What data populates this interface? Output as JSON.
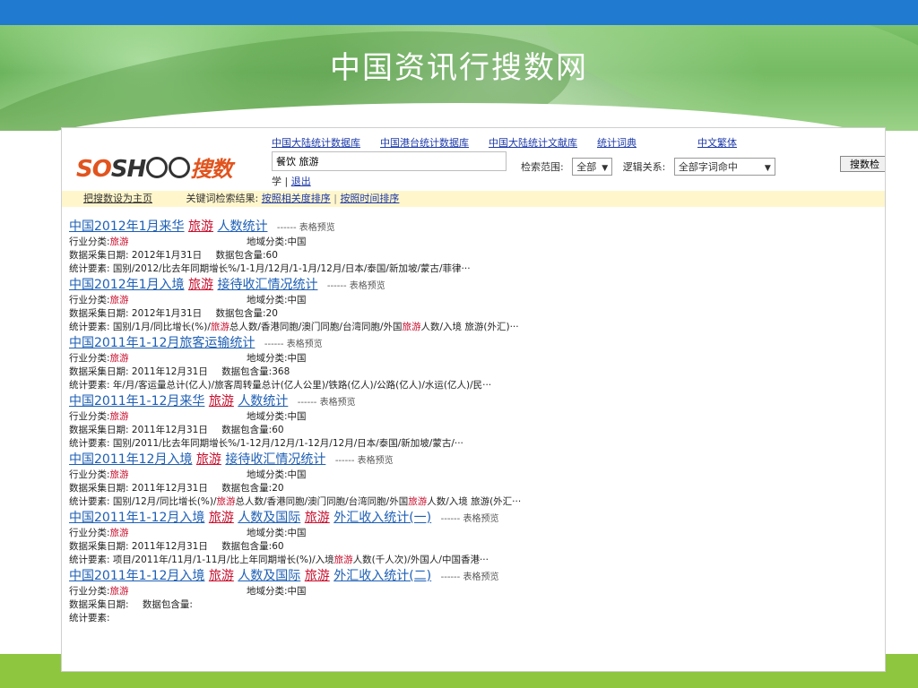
{
  "page_title": "中国资讯行搜数网",
  "header": {
    "db_links": [
      "中国大陆统计数据库",
      "中国港台统计数据库",
      "中国大陆统计文献库",
      "统计词典",
      "中文繁体"
    ],
    "search_value": "餐饮 旅游",
    "user_prefix": "学 | ",
    "logout": "退出",
    "scope_label": "检索范围:",
    "scope_value": "全部",
    "logic_label": "逻辑关系:",
    "logic_value": "全部字词命中",
    "search_button": "搜数检"
  },
  "bar": {
    "set_home": "把搜数设为主页",
    "kw_label": "关键词检索结果:",
    "sort_relevance": "按照相关度排序",
    "separator": "|",
    "sort_time": "按照时间排序"
  },
  "labels": {
    "industry": "行业分类:",
    "region": "地域分类:",
    "date": "数据采集日期:",
    "count": "数据包含量:",
    "elements": "统计要素:",
    "preview": "------ 表格预览"
  },
  "results": [
    {
      "t1": "中国2012年1月来华",
      "t2": "旅游",
      "t3": "人数统计",
      "t4": "",
      "t5": "",
      "industry": "旅游",
      "region": "中国",
      "date": "2012年1月31日",
      "count": "60",
      "e1": "国别/2012/比去年同期增长%/1-1月/12月/1-1月/12月/日本/泰国/新加坡/蒙古/菲律···",
      "e2": "",
      "e3": "",
      "e4": "",
      "e5": ""
    },
    {
      "t1": "中国2012年1月入境",
      "t2": "旅游",
      "t3": "接待收汇情况统计",
      "t4": "",
      "t5": "",
      "industry": "旅游",
      "region": "中国",
      "date": "2012年1月31日",
      "count": "20",
      "e1": "国别/1月/同比增长(%)/",
      "e2": "旅游",
      "e3": "总人数/香港同胞/澳门同胞/台湾同胞/外国",
      "e4": "旅游",
      "e5": "人数/入境 旅游(外汇)···"
    },
    {
      "t1": "中国2011年1-12月旅客运输统计",
      "t2": "",
      "t3": "",
      "t4": "",
      "t5": "",
      "industry": "旅游",
      "region": "中国",
      "date": "2011年12月31日",
      "count": "368",
      "e1": "年/月/客运量总计(亿人)/旅客周转量总计(亿人公里)/铁路(亿人)/公路(亿人)/水运(亿人)/民···",
      "e2": "",
      "e3": "",
      "e4": "",
      "e5": ""
    },
    {
      "t1": "中国2011年1-12月来华",
      "t2": "旅游",
      "t3": "人数统计",
      "t4": "",
      "t5": "",
      "industry": "旅游",
      "region": "中国",
      "date": "2011年12月31日",
      "count": "60",
      "e1": "国别/2011/比去年同期增长%/1-12月/12月/1-12月/12月/日本/泰国/新加坡/蒙古/···",
      "e2": "",
      "e3": "",
      "e4": "",
      "e5": ""
    },
    {
      "t1": "中国2011年12月入境",
      "t2": "旅游",
      "t3": "接待收汇情况统计",
      "t4": "",
      "t5": "",
      "industry": "旅游",
      "region": "中国",
      "date": "2011年12月31日",
      "count": "20",
      "e1": "国别/12月/同比增长(%)/",
      "e2": "旅游",
      "e3": "总人数/香港同胞/澳门同胞/台湾同胞/外国",
      "e4": "旅游",
      "e5": "人数/入境 旅游(外汇···"
    },
    {
      "t1": "中国2011年1-12月入境",
      "t2": "旅游",
      "t3": "人数及国际",
      "t4": "旅游",
      "t5": "外汇收入统计(一)",
      "industry": "旅游",
      "region": "中国",
      "date": "2011年12月31日",
      "count": "60",
      "e1": "项目/2011年/11月/1-11月/比上年同期增长(%)/入境",
      "e2": "旅游",
      "e3": "人数(千人次)/外国人/中国香港···",
      "e4": "",
      "e5": ""
    },
    {
      "t1": "中国2011年1-12月入境",
      "t2": "旅游",
      "t3": "人数及国际",
      "t4": "旅游",
      "t5": "外汇收入统计(二)",
      "industry": "旅游",
      "region": "中国",
      "date": "",
      "count": "",
      "e1": "",
      "e2": "",
      "e3": "",
      "e4": "",
      "e5": ""
    }
  ],
  "colors": {
    "top_bar": "#1f7ad0",
    "footer_bar": "#8ec63f",
    "highlight": "#c8102e",
    "link": "#1d5fb5"
  }
}
